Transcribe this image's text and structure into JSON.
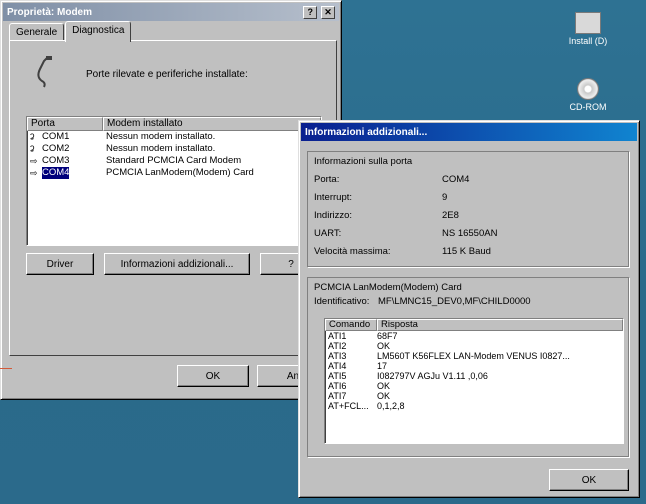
{
  "desktop": {
    "icons": [
      {
        "label": "Install (D)",
        "icon": "drive-icon"
      },
      {
        "label": "CD-ROM",
        "icon": "cdrom-icon"
      }
    ]
  },
  "modem_props": {
    "title": "Proprietà: Modem",
    "help_btn": "?",
    "close_btn": "✕",
    "tabs": [
      {
        "label": "Generale",
        "selected": false
      },
      {
        "label": "Diagnostica",
        "selected": true
      }
    ],
    "description": "Porte rilevate e periferiche installate:",
    "columns": [
      "Porta",
      "Modem installato"
    ],
    "rows": [
      {
        "port": "COM1",
        "modem": "Nessun modem installato.",
        "selected": false
      },
      {
        "port": "COM2",
        "modem": "Nessun modem installato.",
        "selected": false
      },
      {
        "port": "COM3",
        "modem": "Standard PCMCIA Card Modem",
        "selected": false
      },
      {
        "port": "COM4",
        "modem": "PCMCIA LanModem(Modem) Card",
        "selected": true
      }
    ],
    "buttons": {
      "driver": "Driver",
      "more_info": "Informazioni addizionali...",
      "help": "?",
      "ok": "OK",
      "cancel": "An"
    }
  },
  "more_info": {
    "title": "Informazioni addizionali...",
    "port_group_label": "Informazioni sulla porta",
    "port_info": [
      {
        "key": "Porta:",
        "value": "COM4"
      },
      {
        "key": "Interrupt:",
        "value": "9"
      },
      {
        "key": "Indirizzo:",
        "value": "2E8"
      },
      {
        "key": "UART:",
        "value": "NS 16550AN"
      },
      {
        "key": "Velocità massima:",
        "value": "115 K Baud"
      }
    ],
    "modem_group_label": "PCMCIA LanModem(Modem) Card",
    "identifier_label": "Identificativo:",
    "identifier_value": "MF\\LMNC15_DEV0,MF\\CHILD0000",
    "columns": [
      "Comando",
      "Risposta"
    ],
    "responses": [
      {
        "cmd": "ATI1",
        "resp": "68F7"
      },
      {
        "cmd": "ATI2",
        "resp": "OK"
      },
      {
        "cmd": "ATI3",
        "resp": "LM560T K56FLEX LAN-Modem VENUS I0827..."
      },
      {
        "cmd": "ATI4",
        "resp": "17"
      },
      {
        "cmd": "ATI5",
        "resp": "I082797V AGJu V1.11 ,0,06"
      },
      {
        "cmd": "ATI6",
        "resp": "OK"
      },
      {
        "cmd": "ATI7",
        "resp": "OK"
      },
      {
        "cmd": "AT+FCL...",
        "resp": "0,1,2,8"
      }
    ],
    "ok": "OK"
  }
}
